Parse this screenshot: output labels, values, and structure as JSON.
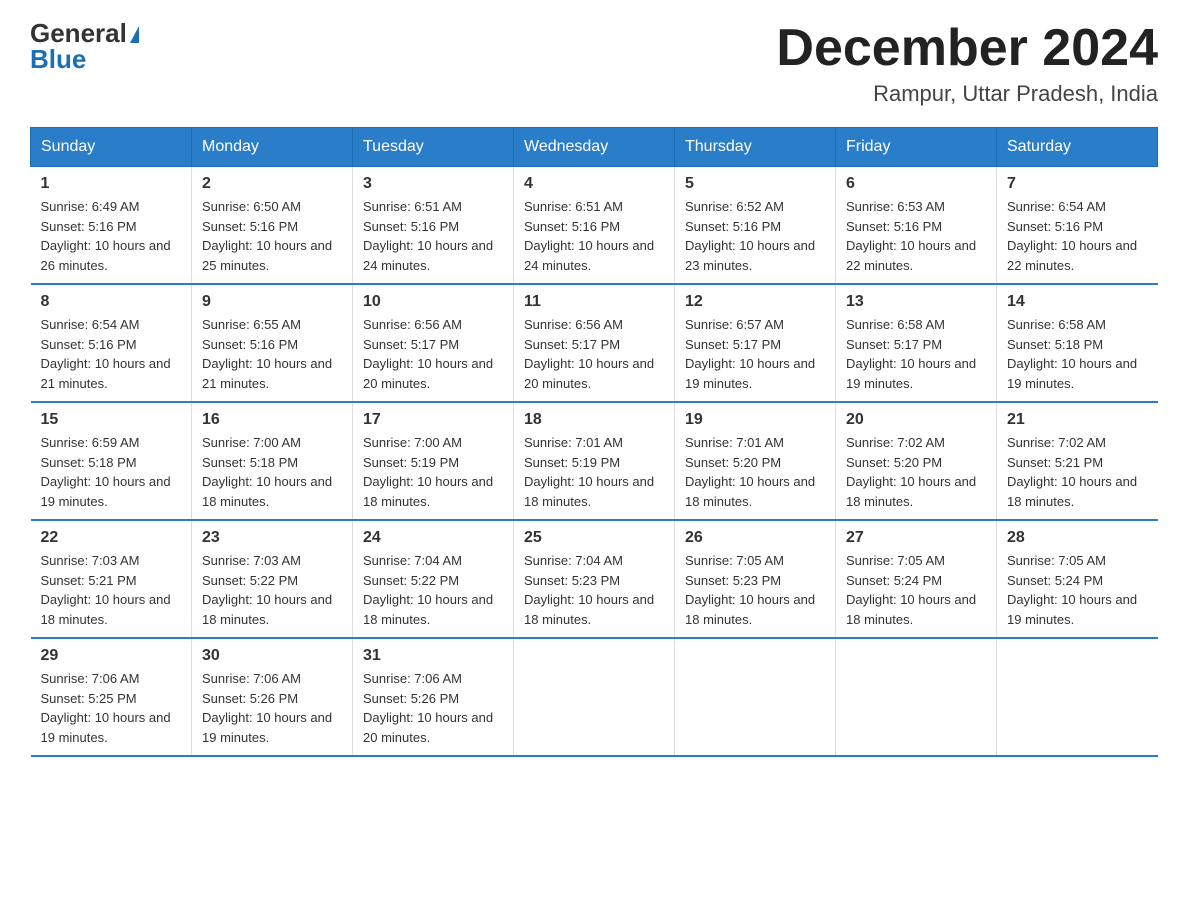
{
  "header": {
    "logo_text1": "General",
    "logo_text2": "Blue",
    "month_year": "December 2024",
    "location": "Rampur, Uttar Pradesh, India"
  },
  "days_of_week": [
    "Sunday",
    "Monday",
    "Tuesday",
    "Wednesday",
    "Thursday",
    "Friday",
    "Saturday"
  ],
  "weeks": [
    [
      {
        "date": "1",
        "sunrise": "6:49 AM",
        "sunset": "5:16 PM",
        "daylight": "10 hours and 26 minutes."
      },
      {
        "date": "2",
        "sunrise": "6:50 AM",
        "sunset": "5:16 PM",
        "daylight": "10 hours and 25 minutes."
      },
      {
        "date": "3",
        "sunrise": "6:51 AM",
        "sunset": "5:16 PM",
        "daylight": "10 hours and 24 minutes."
      },
      {
        "date": "4",
        "sunrise": "6:51 AM",
        "sunset": "5:16 PM",
        "daylight": "10 hours and 24 minutes."
      },
      {
        "date": "5",
        "sunrise": "6:52 AM",
        "sunset": "5:16 PM",
        "daylight": "10 hours and 23 minutes."
      },
      {
        "date": "6",
        "sunrise": "6:53 AM",
        "sunset": "5:16 PM",
        "daylight": "10 hours and 22 minutes."
      },
      {
        "date": "7",
        "sunrise": "6:54 AM",
        "sunset": "5:16 PM",
        "daylight": "10 hours and 22 minutes."
      }
    ],
    [
      {
        "date": "8",
        "sunrise": "6:54 AM",
        "sunset": "5:16 PM",
        "daylight": "10 hours and 21 minutes."
      },
      {
        "date": "9",
        "sunrise": "6:55 AM",
        "sunset": "5:16 PM",
        "daylight": "10 hours and 21 minutes."
      },
      {
        "date": "10",
        "sunrise": "6:56 AM",
        "sunset": "5:17 PM",
        "daylight": "10 hours and 20 minutes."
      },
      {
        "date": "11",
        "sunrise": "6:56 AM",
        "sunset": "5:17 PM",
        "daylight": "10 hours and 20 minutes."
      },
      {
        "date": "12",
        "sunrise": "6:57 AM",
        "sunset": "5:17 PM",
        "daylight": "10 hours and 19 minutes."
      },
      {
        "date": "13",
        "sunrise": "6:58 AM",
        "sunset": "5:17 PM",
        "daylight": "10 hours and 19 minutes."
      },
      {
        "date": "14",
        "sunrise": "6:58 AM",
        "sunset": "5:18 PM",
        "daylight": "10 hours and 19 minutes."
      }
    ],
    [
      {
        "date": "15",
        "sunrise": "6:59 AM",
        "sunset": "5:18 PM",
        "daylight": "10 hours and 19 minutes."
      },
      {
        "date": "16",
        "sunrise": "7:00 AM",
        "sunset": "5:18 PM",
        "daylight": "10 hours and 18 minutes."
      },
      {
        "date": "17",
        "sunrise": "7:00 AM",
        "sunset": "5:19 PM",
        "daylight": "10 hours and 18 minutes."
      },
      {
        "date": "18",
        "sunrise": "7:01 AM",
        "sunset": "5:19 PM",
        "daylight": "10 hours and 18 minutes."
      },
      {
        "date": "19",
        "sunrise": "7:01 AM",
        "sunset": "5:20 PM",
        "daylight": "10 hours and 18 minutes."
      },
      {
        "date": "20",
        "sunrise": "7:02 AM",
        "sunset": "5:20 PM",
        "daylight": "10 hours and 18 minutes."
      },
      {
        "date": "21",
        "sunrise": "7:02 AM",
        "sunset": "5:21 PM",
        "daylight": "10 hours and 18 minutes."
      }
    ],
    [
      {
        "date": "22",
        "sunrise": "7:03 AM",
        "sunset": "5:21 PM",
        "daylight": "10 hours and 18 minutes."
      },
      {
        "date": "23",
        "sunrise": "7:03 AM",
        "sunset": "5:22 PM",
        "daylight": "10 hours and 18 minutes."
      },
      {
        "date": "24",
        "sunrise": "7:04 AM",
        "sunset": "5:22 PM",
        "daylight": "10 hours and 18 minutes."
      },
      {
        "date": "25",
        "sunrise": "7:04 AM",
        "sunset": "5:23 PM",
        "daylight": "10 hours and 18 minutes."
      },
      {
        "date": "26",
        "sunrise": "7:05 AM",
        "sunset": "5:23 PM",
        "daylight": "10 hours and 18 minutes."
      },
      {
        "date": "27",
        "sunrise": "7:05 AM",
        "sunset": "5:24 PM",
        "daylight": "10 hours and 18 minutes."
      },
      {
        "date": "28",
        "sunrise": "7:05 AM",
        "sunset": "5:24 PM",
        "daylight": "10 hours and 19 minutes."
      }
    ],
    [
      {
        "date": "29",
        "sunrise": "7:06 AM",
        "sunset": "5:25 PM",
        "daylight": "10 hours and 19 minutes."
      },
      {
        "date": "30",
        "sunrise": "7:06 AM",
        "sunset": "5:26 PM",
        "daylight": "10 hours and 19 minutes."
      },
      {
        "date": "31",
        "sunrise": "7:06 AM",
        "sunset": "5:26 PM",
        "daylight": "10 hours and 20 minutes."
      },
      null,
      null,
      null,
      null
    ]
  ],
  "labels": {
    "sunrise": "Sunrise:",
    "sunset": "Sunset:",
    "daylight": "Daylight:"
  }
}
